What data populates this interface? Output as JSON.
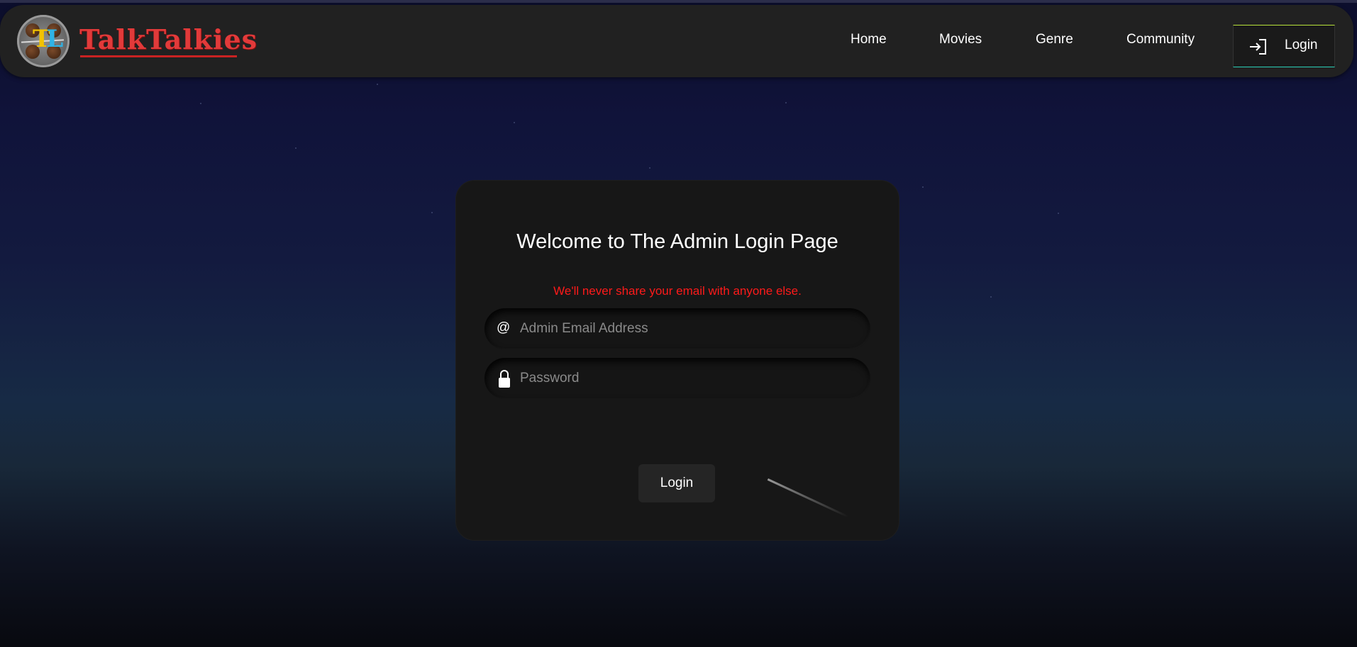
{
  "navbar": {
    "brand": "TalkTalkies",
    "logo_letters": {
      "t": "T",
      "l": "L"
    },
    "items": [
      {
        "label": "Home"
      },
      {
        "label": "Movies"
      },
      {
        "label": "Genre"
      },
      {
        "label": "Community"
      }
    ],
    "login_label": "Login",
    "login_icon": "login-arrow-icon"
  },
  "card": {
    "title": "Welcome to The Admin Login Page",
    "note": "We'll never share your email with anyone else.",
    "email": {
      "placeholder": "Admin Email Address",
      "value": "",
      "icon": "at-icon",
      "icon_glyph": "@"
    },
    "password": {
      "placeholder": "Password",
      "value": "",
      "icon": "lock-icon"
    },
    "submit_label": "Login"
  },
  "colors": {
    "brand": "#e23a3a",
    "note": "#ff1a1a",
    "card_bg": "#171717",
    "navbar_bg": "#212121"
  }
}
